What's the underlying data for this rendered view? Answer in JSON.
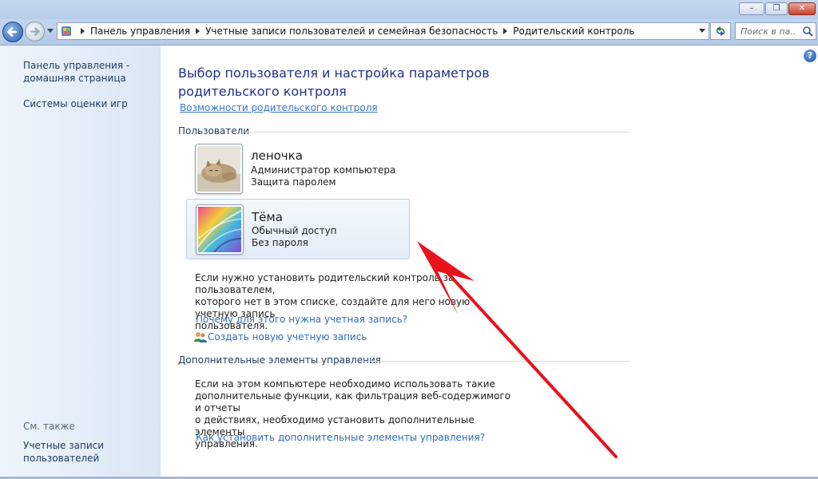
{
  "titlebar": {
    "minimize": "–",
    "maximize": "❐",
    "close": "✕"
  },
  "navigation": {
    "breadcrumb": [
      "Панель управления",
      "Учетные записи пользователей и семейная безопасность",
      "Родительский контроль"
    ],
    "search_placeholder": "Поиск в па..."
  },
  "sidebar": {
    "home_line1": "Панель управления -",
    "home_line2": "домашняя страница",
    "ratings": "Системы оценки игр",
    "see_also": "См. также",
    "accounts_line1": "Учетные записи",
    "accounts_line2": "пользователей"
  },
  "main": {
    "title_line1": "Выбор пользователя и настройка параметров",
    "title_line2": "родительского контроля",
    "features_link": "Возможности родительского контроля",
    "users_heading": "Пользователи",
    "users": [
      {
        "name": "леночка",
        "role": "Администратор компьютера",
        "password": "Защита паролем",
        "avatar": "kitten-avatar"
      },
      {
        "name": "Тёма",
        "role": "Обычный доступ",
        "password": "Без пароля",
        "avatar": "abstract-avatar"
      }
    ],
    "info_line1": "Если нужно установить родительский контроль за пользователем,",
    "info_line2": "которого нет в этом списке, создайте для него новую учетную запись",
    "info_line3": "пользователя.",
    "why_link": "Почему для этого нужна учетная запись?",
    "create_link": "Создать новую учетную запись",
    "extra_heading": "Дополнительные элементы управления",
    "extra_line1": "Если на этом компьютере необходимо использовать такие",
    "extra_line2": "дополнительные функции, как фильтрация веб-содержимого и отчеты",
    "extra_line3": "о действиях, необходимо установить дополнительные элементы",
    "extra_line4": "управления.",
    "install_link": "Как установить дополнительные элементы управления?"
  },
  "help_icon": "?",
  "colors": {
    "accent": "#1e3287",
    "link": "#2e6dbd",
    "arrow": "#e8121c"
  }
}
